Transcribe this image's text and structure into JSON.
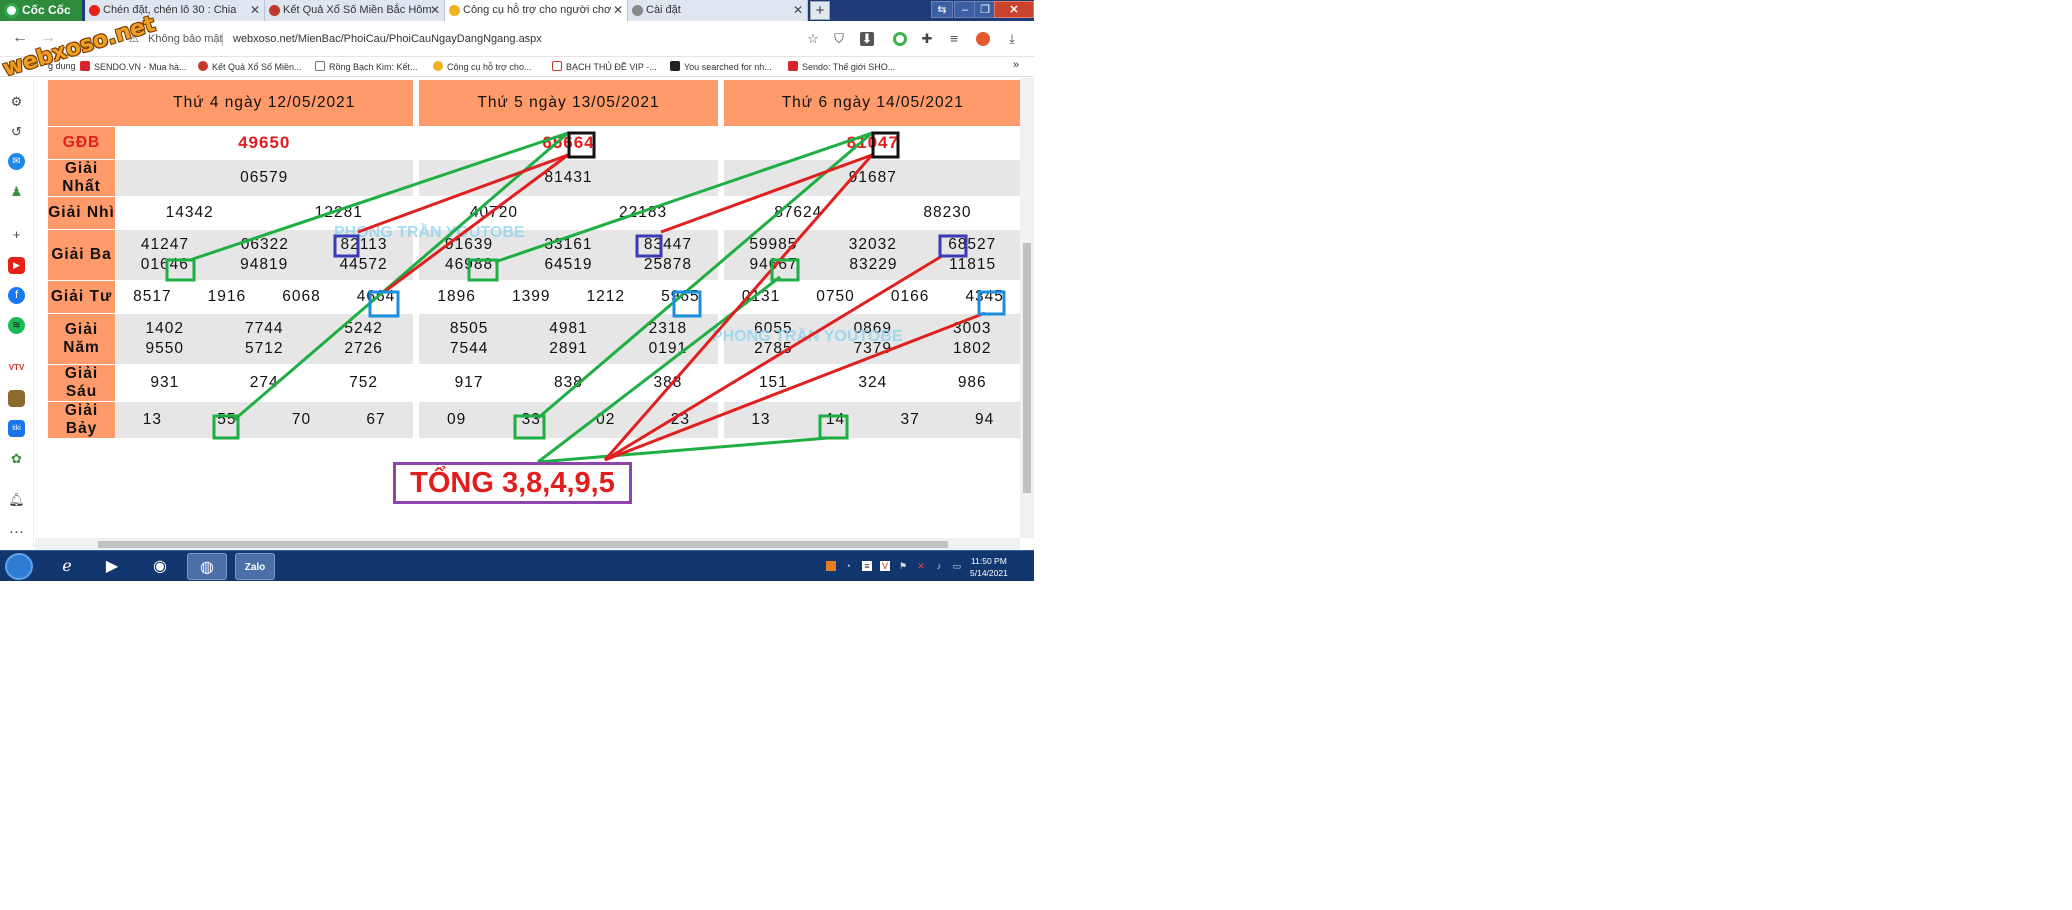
{
  "browser": {
    "brand": "Cốc Cốc",
    "tabs": [
      {
        "label": "Chén đặt, chén lô 30 : Chia"
      },
      {
        "label": "Kết Quả Xổ Số Miền Bắc Hôm"
      },
      {
        "label": "Công cụ hỗ trợ cho người chơ"
      },
      {
        "label": "Cài đặt"
      }
    ],
    "security_label": "Không bảo mật",
    "url": "webxoso.net/MienBac/PhoiCau/PhoiCauNgayDangNgang.aspx",
    "bookmarks": [
      {
        "label": "g dụng"
      },
      {
        "label": "SENDO.VN - Mua hà..."
      },
      {
        "label": "Kết Quả Xổ Số Miền..."
      },
      {
        "label": "Rồng Bạch Kim: Kết..."
      },
      {
        "label": "Công cụ hỗ trợ cho..."
      },
      {
        "label": "BẠCH THỦ ĐỀ VIP -..."
      },
      {
        "label": "You searched for nh..."
      },
      {
        "label": "Sendo: Thế giới SHO..."
      }
    ]
  },
  "watermark": {
    "site": "webxoso.net",
    "channel1": "PHONG TRẦN YOUTOBE",
    "channel2": "PHONG TRẦN YOUTOBE"
  },
  "results": {
    "labels": [
      "GĐB",
      "Giải Nhất",
      "Giải Nhì",
      "Giải Ba",
      "Giải Tư",
      "Giải Năm",
      "Giải Sáu",
      "Giải Bảy"
    ],
    "days": [
      {
        "date": "Thứ 4 ngày 12/05/2021",
        "gdb": "49650",
        "nhat": "06579",
        "nhi": [
          "14342",
          "12281"
        ],
        "ba": [
          "41247",
          "06322",
          "82113",
          "01646",
          "94819",
          "44572"
        ],
        "tu": [
          "8517",
          "1916",
          "6068",
          "4664"
        ],
        "nam": [
          "1402",
          "7744",
          "5242",
          "9550",
          "5712",
          "2726"
        ],
        "sau": [
          "931",
          "274",
          "752"
        ],
        "bay": [
          "13",
          "55",
          "70",
          "67"
        ]
      },
      {
        "date": "Thứ 5 ngày 13/05/2021",
        "gdb": "65664",
        "nhat": "81431",
        "nhi": [
          "40720",
          "22183"
        ],
        "ba": [
          "91639",
          "33161",
          "83447",
          "46988",
          "64519",
          "25878"
        ],
        "tu": [
          "1896",
          "1399",
          "1212",
          "5965"
        ],
        "nam": [
          "8505",
          "4981",
          "2318",
          "7544",
          "2891",
          "0191"
        ],
        "sau": [
          "917",
          "838",
          "388"
        ],
        "bay": [
          "09",
          "33",
          "02",
          "23"
        ]
      },
      {
        "date": "Thứ 6 ngày 14/05/2021",
        "gdb": "81047",
        "nhat": "91687",
        "nhi": [
          "87624",
          "88230"
        ],
        "ba": [
          "59985",
          "32032",
          "68527",
          "94667",
          "83229",
          "11815"
        ],
        "tu": [
          "0131",
          "0750",
          "0166",
          "4345"
        ],
        "nam": [
          "6055",
          "0869",
          "3003",
          "2785",
          "7379",
          "1802"
        ],
        "sau": [
          "151",
          "324",
          "986"
        ],
        "bay": [
          "13",
          "14",
          "37",
          "94"
        ]
      }
    ]
  },
  "total_label": "TỔNG 3,8,4,9,5",
  "taskbar": {
    "time": "11:50 PM",
    "date": "5/14/2021"
  },
  "colors": {
    "header": "#ff9b6a",
    "special": "#e21d1d",
    "green_line": "#1fae43",
    "red_line": "#e02020",
    "blue_box": "#3b3bb8",
    "cyan_box": "#1a8fe0",
    "total_border": "#8e44ad"
  }
}
